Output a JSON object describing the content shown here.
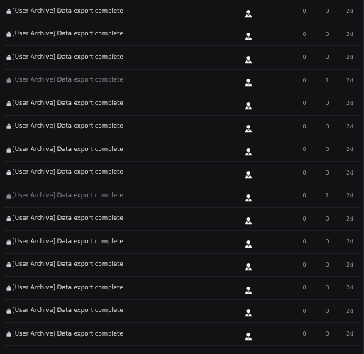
{
  "topics": [
    {
      "title": "[User Archive] Data export complete",
      "replies": "0",
      "views": "0",
      "activity": "2d",
      "read": false
    },
    {
      "title": "[User Archive] Data export complete",
      "replies": "0",
      "views": "0",
      "activity": "2d",
      "read": false
    },
    {
      "title": "[User Archive] Data export complete",
      "replies": "0",
      "views": "0",
      "activity": "2d",
      "read": false
    },
    {
      "title": "[User Archive] Data export complete",
      "replies": "0",
      "views": "1",
      "activity": "2d",
      "read": true
    },
    {
      "title": "[User Archive] Data export complete",
      "replies": "0",
      "views": "0",
      "activity": "2d",
      "read": false
    },
    {
      "title": "[User Archive] Data export complete",
      "replies": "0",
      "views": "0",
      "activity": "2d",
      "read": false
    },
    {
      "title": "[User Archive] Data export complete",
      "replies": "0",
      "views": "0",
      "activity": "2d",
      "read": false
    },
    {
      "title": "[User Archive] Data export complete",
      "replies": "0",
      "views": "0",
      "activity": "2d",
      "read": false
    },
    {
      "title": "[User Archive] Data export complete",
      "replies": "0",
      "views": "1",
      "activity": "2d",
      "read": true
    },
    {
      "title": "[User Archive] Data export complete",
      "replies": "0",
      "views": "0",
      "activity": "2d",
      "read": false
    },
    {
      "title": "[User Archive] Data export complete",
      "replies": "0",
      "views": "0",
      "activity": "2d",
      "read": false
    },
    {
      "title": "[User Archive] Data export complete",
      "replies": "0",
      "views": "0",
      "activity": "2d",
      "read": false
    },
    {
      "title": "[User Archive] Data export complete",
      "replies": "0",
      "views": "0",
      "activity": "2d",
      "read": false
    },
    {
      "title": "[User Archive] Data export complete",
      "replies": "0",
      "views": "0",
      "activity": "2d",
      "read": false
    },
    {
      "title": "[User Archive] Data export complete",
      "replies": "0",
      "views": "0",
      "activity": "2d",
      "read": false
    }
  ],
  "icons": {
    "lock": "lock-icon",
    "poster": "user-avatar-icon"
  },
  "colors": {
    "background": "#111214",
    "unread_title": "#ececec",
    "read_title": "#8d8f93",
    "count": "#9c9ea3"
  }
}
